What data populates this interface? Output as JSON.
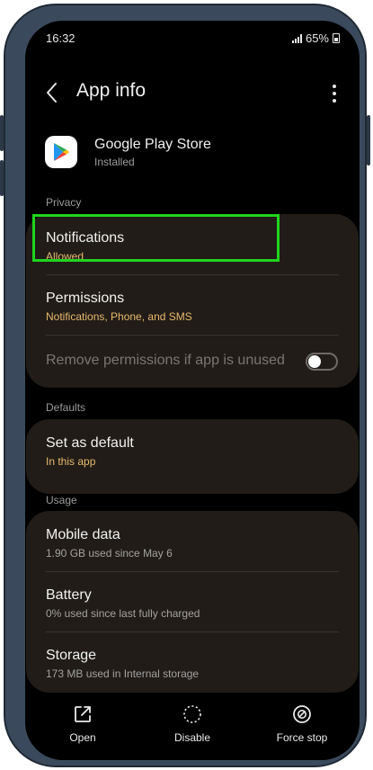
{
  "status_bar": {
    "time": "16:32",
    "battery_percent": "65%"
  },
  "app_bar": {
    "title": "App info"
  },
  "app": {
    "name": "Google Play Store",
    "status": "Installed"
  },
  "sections": {
    "privacy": "Privacy",
    "defaults": "Defaults",
    "usage": "Usage"
  },
  "privacy_items": {
    "notifications": {
      "title": "Notifications",
      "subtitle": "Allowed"
    },
    "permissions": {
      "title": "Permissions",
      "subtitle": "Notifications, Phone, and SMS"
    },
    "remove_permissions": {
      "title": "Remove permissions if app is unused",
      "enabled": false
    }
  },
  "defaults_items": {
    "set_as_default": {
      "title": "Set as default",
      "subtitle": "In this app"
    }
  },
  "usage_items": {
    "mobile_data": {
      "title": "Mobile data",
      "subtitle": "1.90 GB used since May 6"
    },
    "battery": {
      "title": "Battery",
      "subtitle": "0% used since last fully charged"
    },
    "storage": {
      "title": "Storage",
      "subtitle": "173 MB used in Internal storage"
    }
  },
  "bottom_actions": {
    "open": "Open",
    "disable": "Disable",
    "force_stop": "Force stop"
  },
  "icons": {
    "back": "chevron-left-icon",
    "more": "more-vertical-icon",
    "app": "google-play-icon",
    "open": "open-external-icon",
    "disable": "disable-circle-icon",
    "force_stop": "force-stop-icon"
  },
  "colors": {
    "highlight": "#1fd41f",
    "accent_subtitle": "#e8b96f",
    "card_bg": "#211c17",
    "frame": "#3a4a5c"
  }
}
